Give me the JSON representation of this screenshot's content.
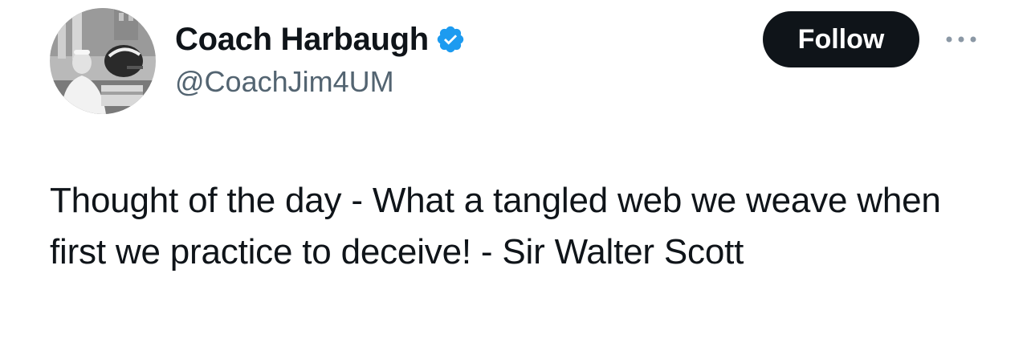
{
  "author": {
    "display_name": "Coach Harbaugh",
    "handle": "@CoachJim4UM",
    "verified": true,
    "avatar_icon": "profile-photo"
  },
  "actions": {
    "follow_label": "Follow",
    "more_icon": "more-horizontal-icon"
  },
  "tweet": {
    "text": "Thought of the day - What a tangled web we weave when first we practice to deceive! - Sir Walter Scott"
  },
  "colors": {
    "text_primary": "#0f1419",
    "text_secondary": "#536471",
    "verified_badge": "#1d9bf0",
    "follow_button_bg": "#0f1419",
    "follow_button_text": "#ffffff"
  }
}
